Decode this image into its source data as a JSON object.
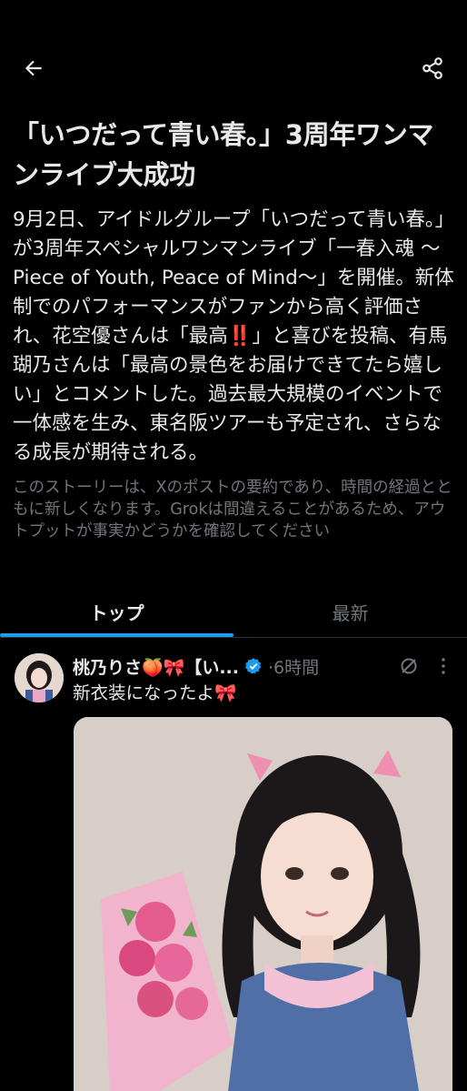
{
  "header": {
    "back_icon": "arrow-left-icon",
    "share_icon": "share-icon"
  },
  "story": {
    "headline": "「いつだって青い春。」3周年ワンマンライブ大成功",
    "summary": "9月2日、アイドルグループ「いつだって青い春。」が3周年スペシャルワンマンライブ「一春入魂 〜Piece of Youth, Peace of Mind〜」を開催。新体制でのパフォーマンスがファンから高く評価され、花空優さんは「最高‼️」と喜びを投稿、有馬瑚乃さんは「最高の景色をお届けできてたら嬉しい」とコメントした。過去最大規模のイベントで一体感を生み、東名阪ツアーも予定され、さらなる成長が期待される。",
    "disclaimer": "このストーリーは、Xのポストの要約であり、時間の経過とともに新しくなります。Grokは間違えることがあるため、アウトプットが事実かどうかを確認してください"
  },
  "tabs": [
    {
      "label": "トップ",
      "active": true
    },
    {
      "label": "最新",
      "active": false
    }
  ],
  "post": {
    "author": "桃乃りさ🍑🎀【い...",
    "time": "·6時間",
    "text": "新衣装になったよ🎀",
    "verified_icon": "verified-badge-icon",
    "grok_icon": "grok-icon",
    "more_icon": "more-vertical-icon"
  },
  "colors": {
    "background": "#000000",
    "text": "#e7e9ea",
    "muted": "#71767b",
    "accent": "#1d9bf0"
  }
}
